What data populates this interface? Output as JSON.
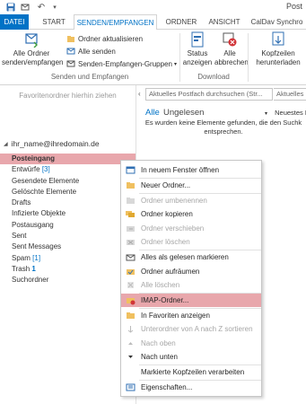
{
  "titlebar": {
    "title_fragment": "Post",
    "quick_access": [
      "save-icon",
      "send-receive-icon",
      "undo-icon",
      "customize-icon"
    ]
  },
  "tabs": [
    {
      "label": "DATEI",
      "state": "file"
    },
    {
      "label": "START",
      "state": "normal"
    },
    {
      "label": "SENDEN/EMPFANGEN",
      "state": "active"
    },
    {
      "label": "ORDNER",
      "state": "normal"
    },
    {
      "label": "ANSICHT",
      "state": "normal"
    },
    {
      "label": "CalDav Synchro",
      "state": "normal"
    }
  ],
  "ribbon": {
    "send_receive_all": "Alle Ordner senden/empfangen",
    "update_folder": "Ordner aktualisieren",
    "send_all": "Alle senden",
    "send_receive_groups": "Senden-Empfangen-Gruppen",
    "group_send_receive": "Senden und Empfangen",
    "show_progress": "Status anzeigen",
    "cancel_all": "Alle abbrechen",
    "group_download": "Download",
    "download_headers": "Kopfzeilen herunterladen"
  },
  "nav": {
    "favorites_hint": "Favoritenordner hierhin ziehen",
    "account": "ihr_name@ihredomain.de",
    "folders": [
      {
        "name": "Posteingang",
        "count": "",
        "selected": true
      },
      {
        "name": "Entwürfe",
        "count": "[3]",
        "selected": false
      },
      {
        "name": "Gesendete Elemente",
        "count": "",
        "selected": false
      },
      {
        "name": "Gelöschte Elemente",
        "count": "",
        "selected": false
      },
      {
        "name": "Drafts",
        "count": "",
        "selected": false
      },
      {
        "name": "Infizierte Objekte",
        "count": "",
        "selected": false
      },
      {
        "name": "Postausgang",
        "count": "",
        "selected": false
      },
      {
        "name": "Sent",
        "count": "",
        "selected": false
      },
      {
        "name": "Sent Messages",
        "count": "",
        "selected": false
      },
      {
        "name": "Spam",
        "count": "[1]",
        "selected": false
      },
      {
        "name": "Trash",
        "count": "1",
        "selected": false
      },
      {
        "name": "Suchordner",
        "count": "",
        "selected": false
      }
    ]
  },
  "content": {
    "search_placeholder": "Aktuelles Postfach durchsuchen (Str...",
    "search_scope": "Aktuelles",
    "filter_all": "Alle",
    "filter_unread": "Ungelesen",
    "sort_label": "Neuestes E",
    "empty_message": "Es wurden keine Elemente gefunden, die den Suchk entsprechen."
  },
  "context_menu": {
    "items": [
      {
        "label": "In neuem Fenster öffnen",
        "icon": "open-window-icon",
        "disabled": false,
        "highlight": false,
        "sep_after": true
      },
      {
        "label": "Neuer Ordner...",
        "icon": "new-folder-icon",
        "disabled": false,
        "highlight": false,
        "sep_after": true
      },
      {
        "label": "Ordner umbenennen",
        "icon": "rename-folder-icon",
        "disabled": true,
        "highlight": false,
        "sep_after": false
      },
      {
        "label": "Ordner kopieren",
        "icon": "copy-folder-icon",
        "disabled": false,
        "highlight": false,
        "sep_after": false
      },
      {
        "label": "Ordner verschieben",
        "icon": "move-folder-icon",
        "disabled": true,
        "highlight": false,
        "sep_after": false
      },
      {
        "label": "Ordner löschen",
        "icon": "delete-folder-icon",
        "disabled": true,
        "highlight": false,
        "sep_after": true
      },
      {
        "label": "Alles als gelesen markieren",
        "icon": "mark-read-icon",
        "disabled": false,
        "highlight": false,
        "sep_after": false
      },
      {
        "label": "Ordner aufräumen",
        "icon": "cleanup-folder-icon",
        "disabled": false,
        "highlight": false,
        "sep_after": false
      },
      {
        "label": "Alle löschen",
        "icon": "delete-all-icon",
        "disabled": true,
        "highlight": false,
        "sep_after": true
      },
      {
        "label": "IMAP-Ordner...",
        "icon": "imap-folder-icon",
        "disabled": false,
        "highlight": true,
        "sep_after": true
      },
      {
        "label": "In Favoriten anzeigen",
        "icon": "favorites-icon",
        "disabled": false,
        "highlight": false,
        "sep_after": false
      },
      {
        "label": "Unterordner von A nach Z sortieren",
        "icon": "sort-az-icon",
        "disabled": true,
        "highlight": false,
        "sep_after": false
      },
      {
        "label": "Nach oben",
        "icon": "move-up-icon",
        "disabled": true,
        "highlight": false,
        "sep_after": false
      },
      {
        "label": "Nach unten",
        "icon": "move-down-icon",
        "disabled": false,
        "highlight": false,
        "sep_after": true
      },
      {
        "label": "Markierte Kopfzeilen verarbeiten",
        "icon": "process-headers-icon",
        "disabled": false,
        "highlight": false,
        "sep_after": true
      },
      {
        "label": "Eigenschaften...",
        "icon": "properties-icon",
        "disabled": false,
        "highlight": false,
        "sep_after": false
      }
    ]
  }
}
